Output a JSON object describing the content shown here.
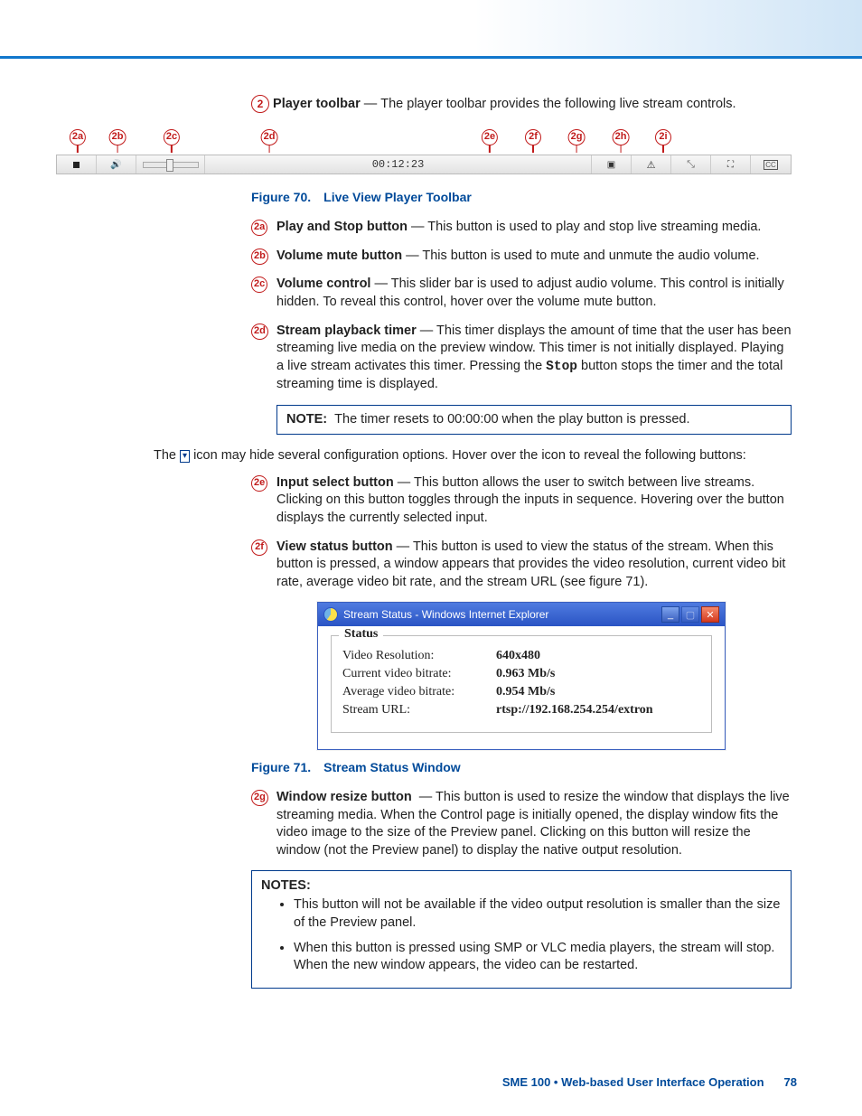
{
  "section": {
    "num": "2",
    "title": "Player toolbar",
    "desc": "The player toolbar provides the following live stream controls."
  },
  "toolbar": {
    "markers": [
      "2a",
      "2b",
      "2c",
      "2d",
      "2e",
      "2f",
      "2g",
      "2h",
      "2i"
    ],
    "timer": "00:12:23",
    "cc": "CC"
  },
  "fig70": {
    "num": "Figure 70.",
    "title": "Live View Player Toolbar"
  },
  "fig71": {
    "num": "Figure 71.",
    "title": "Stream Status Window"
  },
  "items": {
    "a": {
      "id": "2a",
      "t": "Play and Stop button",
      "d": "This button is used to play and stop live streaming media."
    },
    "b": {
      "id": "2b",
      "t": "Volume mute button",
      "d": "This button is used to mute and unmute the audio volume."
    },
    "c": {
      "id": "2c",
      "t": "Volume control",
      "d": "This slider bar is used to adjust audio volume. This control is initially hidden. To reveal this control, hover over the volume mute button."
    },
    "d": {
      "id": "2d",
      "t": "Stream playback timer",
      "d1": "This timer displays the amount of time that the user has been streaming live media on the preview window. This timer is not initially displayed. Playing a live stream activates this timer. Pressing the ",
      "stop": "Stop",
      "d2": " button stops the timer and the total streaming time is displayed."
    },
    "e": {
      "id": "2e",
      "t": "Input select button",
      "d": "This button allows the user to switch between live streams. Clicking on this button toggles through the inputs in sequence. Hovering over the button displays the currently selected input."
    },
    "f": {
      "id": "2f",
      "t": "View status button",
      "d": "This button is used to view the status of the stream. When this button is pressed, a window appears that provides the video resolution, current video bit rate, average video bit rate, and the stream URL (see figure 71)."
    },
    "g": {
      "id": "2g",
      "t": "Window resize button",
      "d": "This button is used to resize the window that displays the live streaming media. When the Control page is initially opened, the display window fits the video image to the size of the Preview panel. Clicking on this button will resize the window (not the Preview panel) to display the native output resolution."
    }
  },
  "note1": {
    "label": "NOTE:",
    "text": "The timer resets to 00:00:00 when the play button is pressed."
  },
  "hoverText": {
    "p1": "The ",
    "p2": " icon may hide several configuration options. Hover over the icon to reveal the following buttons:",
    "iconGlyph": "▾"
  },
  "statusWin": {
    "title": "Stream Status - Windows Internet Explorer",
    "legend": "Status",
    "rows": [
      {
        "k": "Video Resolution:",
        "v": "640x480"
      },
      {
        "k": "Current video bitrate:",
        "v": "0.963 Mb/s"
      },
      {
        "k": "Average video bitrate:",
        "v": "0.954 Mb/s"
      },
      {
        "k": "Stream URL:",
        "v": "rtsp://192.168.254.254/extron"
      }
    ]
  },
  "notes2": {
    "label": "NOTES:",
    "bullets": [
      "This button will not be available if the video output resolution is smaller than the size of the Preview panel.",
      "When this button is pressed using SMP or VLC media players, the stream will stop. When the new window appears, the video can be restarted."
    ]
  },
  "footer": {
    "text": "SME 100 • Web-based User Interface Operation",
    "page": "78"
  }
}
